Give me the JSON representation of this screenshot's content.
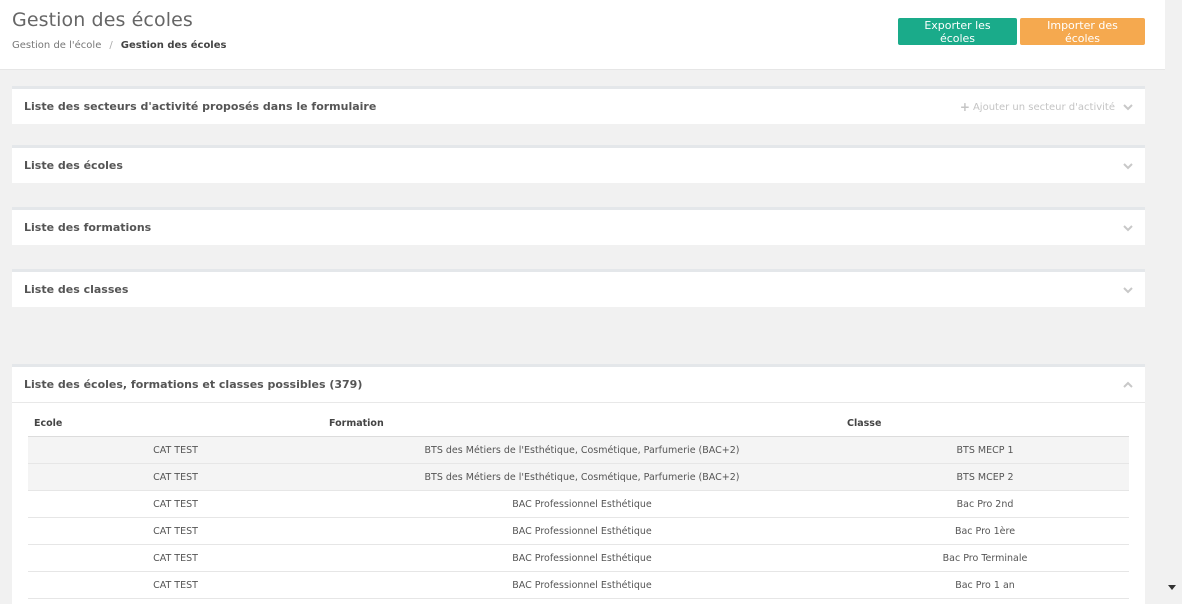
{
  "header": {
    "title": "Gestion des écoles",
    "breadcrumb": {
      "parent": "Gestion de l'école",
      "separator": "/",
      "current": "Gestion des écoles"
    },
    "export_label": "Exporter les écoles",
    "import_label": "Importer des écoles"
  },
  "colors": {
    "export_button": "#1aab8a",
    "import_button": "#f5a94f",
    "background": "#f1f1f1"
  },
  "panels": {
    "sectors": {
      "title": "Liste des secteurs d'activité proposés dans le formulaire",
      "action_label": "Ajouter un secteur d'activité",
      "expanded": false
    },
    "schools": {
      "title": "Liste des écoles",
      "expanded": false
    },
    "trainings": {
      "title": "Liste des formations",
      "expanded": false
    },
    "classes": {
      "title": "Liste des classes",
      "expanded": false
    },
    "combinations": {
      "title": "Liste des écoles, formations et classes possibles (379)",
      "expanded": true
    }
  },
  "table": {
    "headers": [
      "Ecole",
      "Formation",
      "Classe"
    ],
    "rows": [
      [
        "CAT TEST",
        "BTS des Métiers de l'Esthétique, Cosmétique, Parfumerie (BAC+2)",
        "BTS MECP 1"
      ],
      [
        "CAT TEST",
        "BTS des Métiers de l'Esthétique, Cosmétique, Parfumerie (BAC+2)",
        "BTS MCEP 2"
      ],
      [
        "CAT TEST",
        "BAC Professionnel Esthétique",
        "Bac Pro 2nd"
      ],
      [
        "CAT TEST",
        "BAC Professionnel Esthétique",
        "Bac Pro 1ère"
      ],
      [
        "CAT TEST",
        "BAC Professionnel Esthétique",
        "Bac Pro Terminale"
      ],
      [
        "CAT TEST",
        "BAC Professionnel Esthétique",
        "Bac Pro 1 an"
      ]
    ]
  },
  "icons": {
    "chevron_down": "chevron-down-icon",
    "chevron_up": "chevron-up-icon",
    "plus": "plus-icon"
  }
}
